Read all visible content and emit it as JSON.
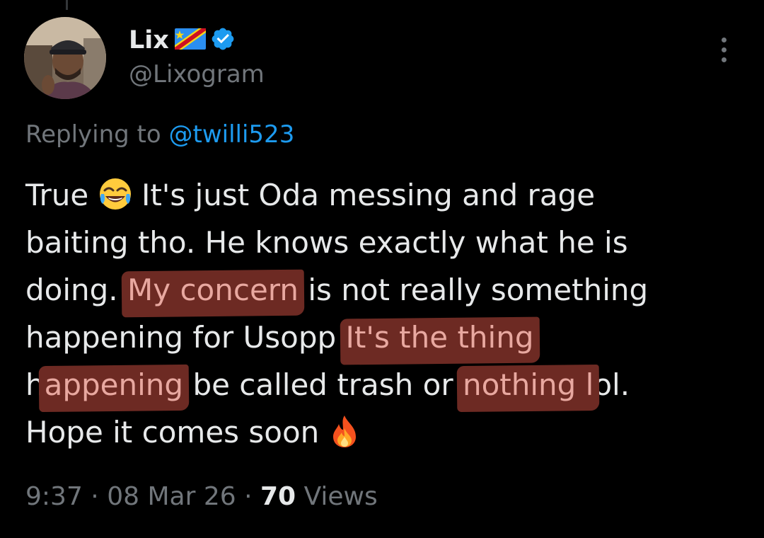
{
  "author": {
    "display_name": "Lix",
    "handle": "@Lixogram",
    "flag_icon": "dr-congo-flag-icon",
    "verified_icon": "verified-badge-icon",
    "verified_color": "#1d9bf0"
  },
  "reply": {
    "prefix": "Replying to",
    "handle": "@twilli523"
  },
  "tweet": {
    "line1_a": "True",
    "line1_emoji": "face-with-tears-of-joy-icon",
    "line1_b": "It's just Oda messing and rage",
    "line2": "baiting tho. He knows exactly what he is",
    "line3_a": "doing.",
    "line3_hl": "My concern",
    "line3_b": "is not really something",
    "line4_a": "happening for Usopp",
    "line4_hl": "It's the thing",
    "line5_a": "h",
    "line5_hl1": "appening",
    "line5_b": "be called trash or",
    "line5_hl2": "nothing l",
    "line5_c": "ol.",
    "line6_a": "Hope it comes soon",
    "line6_emoji": "fire-icon"
  },
  "meta": {
    "time": "9:37",
    "date": "08 Mar 26",
    "sep": "·",
    "views_count": "70",
    "views_label": "Views"
  },
  "colors": {
    "background": "#000000",
    "text": "#e7e9ea",
    "secondary": "#71767b",
    "link": "#1d9bf0",
    "highlight_marker": "#6d2a23"
  }
}
